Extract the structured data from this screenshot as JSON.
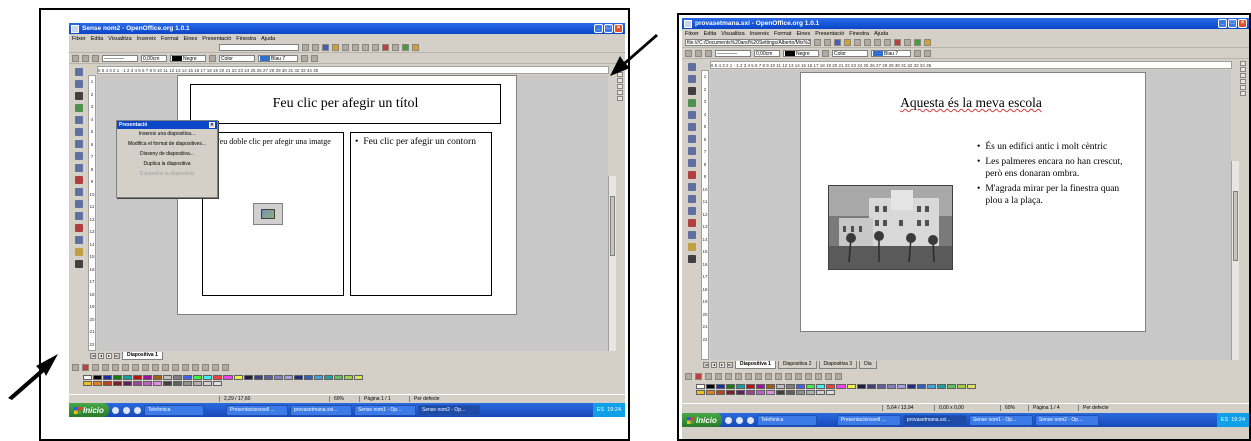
{
  "left": {
    "window_title": "Sense nom2 - OpenOffice.org 1.0.1",
    "menu": [
      "Fitxer",
      "Edita",
      "Visualitza",
      "Insereix",
      "Format",
      "Eines",
      "Presentació",
      "Finestra",
      "Ajuda"
    ],
    "line_width": "0,00cm",
    "color1": "Negre",
    "fill_type": "Color",
    "color2": "Blau 7",
    "hruler": "6 5 4 3 2 1 · 1 2 3 4 5 6 7 8 9 10 11 12 13 14 15 16 17 18 19 20 21 22 23 24 25 26 27 28 29 30 31 32 33 34 35",
    "vruler": [
      "1",
      "2",
      "3",
      "4",
      "5",
      "6",
      "7",
      "8",
      "9",
      "10",
      "11",
      "12",
      "13",
      "14",
      "15",
      "16",
      "17",
      "18",
      "19",
      "20",
      "21",
      "22"
    ],
    "title_placeholder": "Feu clic per afegir un títol",
    "image_placeholder": "Feu doble clic per afegir una imatge",
    "outline_placeholder": "Feu clic per afegir un contorn",
    "dialog": {
      "title": "Presentació",
      "items": [
        "Insereix una diapositiva...",
        "Modifica el format de diapositives...",
        "Disseny de diapositiva...",
        "Duplica la diapositiva",
        "Expandeix la diapositiva"
      ]
    },
    "tabs": [
      "Diapositiva 1"
    ],
    "status": {
      "position": "2,29 / 17,60",
      "zoom": "60%",
      "page": "Pàgina 1 / 1",
      "style": "Per defecte"
    },
    "taskbar": {
      "start": "Inicio",
      "tasks": [
        "Telefonica",
        "Presentacionsvell ...",
        "provasetmana.sxi...",
        "Sense nom1 - Op...",
        "Sense nom2 - Op..."
      ],
      "clock": "19:24",
      "lang": "ES"
    }
  },
  "right": {
    "window_title": "provasetmana.sxi - OpenOffice.org 1.0.1",
    "menu": [
      "Fitxer",
      "Edita",
      "Visualitza",
      "Insereix",
      "Format",
      "Eines",
      "Presentació",
      "Finestra",
      "Ajuda"
    ],
    "url": "file:///C:/Documents%20and%20Settings/Alberto/Mis%2...",
    "line_width": "0,00cm",
    "color1": "Negre",
    "fill_type": "Color",
    "color2": "Blau 7",
    "hruler": "6 5 4 3 2 1 · 1 2 3 4 5 6 7 8 9 10 11 12 13 14 15 16 17 18 19 20 21 22 23 24 25 26 27 28 29 30 31 32 33 34 35",
    "vruler": [
      "1",
      "2",
      "3",
      "4",
      "5",
      "6",
      "7",
      "8",
      "9",
      "10",
      "11",
      "12",
      "13",
      "14",
      "15",
      "16",
      "17",
      "18",
      "19",
      "20",
      "21",
      "22"
    ],
    "slide_title": "Aquesta és la meva escola",
    "bullets": [
      "És un edifici antic i molt cèntric",
      "Les palmeres encara no han crescut, però ens donaran ombra.",
      "M'agrada mirar per la finestra quan plou a la plaça."
    ],
    "tabs": [
      "Diapositiva 1",
      "Diapositiva 2",
      "Diapositiva 3",
      "Dia"
    ],
    "status": {
      "position": "5,64 / 13,94",
      "size": "0,00 x 0,00",
      "zoom": "60%",
      "page": "Pàgina 1 / 4",
      "style": "Per defecte"
    },
    "taskbar": {
      "start": "Inicio",
      "tasks": [
        "Telefonica",
        "Presentacionsvell ...",
        "provasetmana.sxi...",
        "Sense nom1 - Op...",
        "Sense nom2 - Op..."
      ],
      "clock": "19:24",
      "lang": "ES"
    }
  },
  "colors": {
    "titlebar": "#0a46c8",
    "taskbar": "#2a6ae0",
    "start": "#2a7a2a",
    "chrome": "#d4d0c8"
  }
}
